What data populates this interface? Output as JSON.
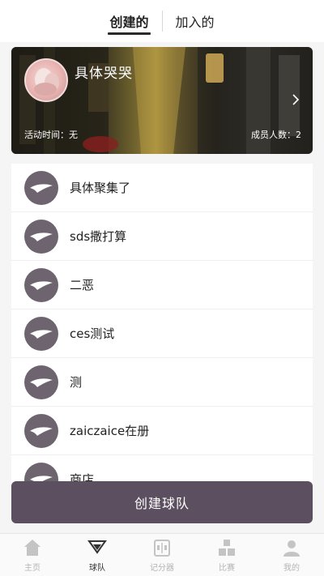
{
  "tabs": [
    {
      "label": "创建的",
      "active": true
    },
    {
      "label": "加入的",
      "active": false
    }
  ],
  "featured_team": {
    "name": "具体哭哭",
    "activity_time": "活动时间：无",
    "member_count": "成员人数：2"
  },
  "teams": [
    {
      "name": "具体聚集了"
    },
    {
      "name": "sds撒打算"
    },
    {
      "name": "二恶"
    },
    {
      "name": "ces测试"
    },
    {
      "name": "测"
    },
    {
      "name": "zaiczaice在册"
    },
    {
      "name": "商店"
    }
  ],
  "create_button": {
    "label": "创建球队"
  },
  "bottom_nav": [
    {
      "label": "主页",
      "icon": "home-icon",
      "active": false
    },
    {
      "label": "球队",
      "icon": "team-icon",
      "active": true
    },
    {
      "label": "记分器",
      "icon": "scoreboard-icon",
      "active": false
    },
    {
      "label": "比赛",
      "icon": "match-icon",
      "active": false
    },
    {
      "label": "我的",
      "icon": "profile-icon",
      "active": false
    }
  ],
  "colors": {
    "accent": "#5c5060",
    "avatar": "#6e6470",
    "inactive_nav": "#b5b5b5"
  }
}
